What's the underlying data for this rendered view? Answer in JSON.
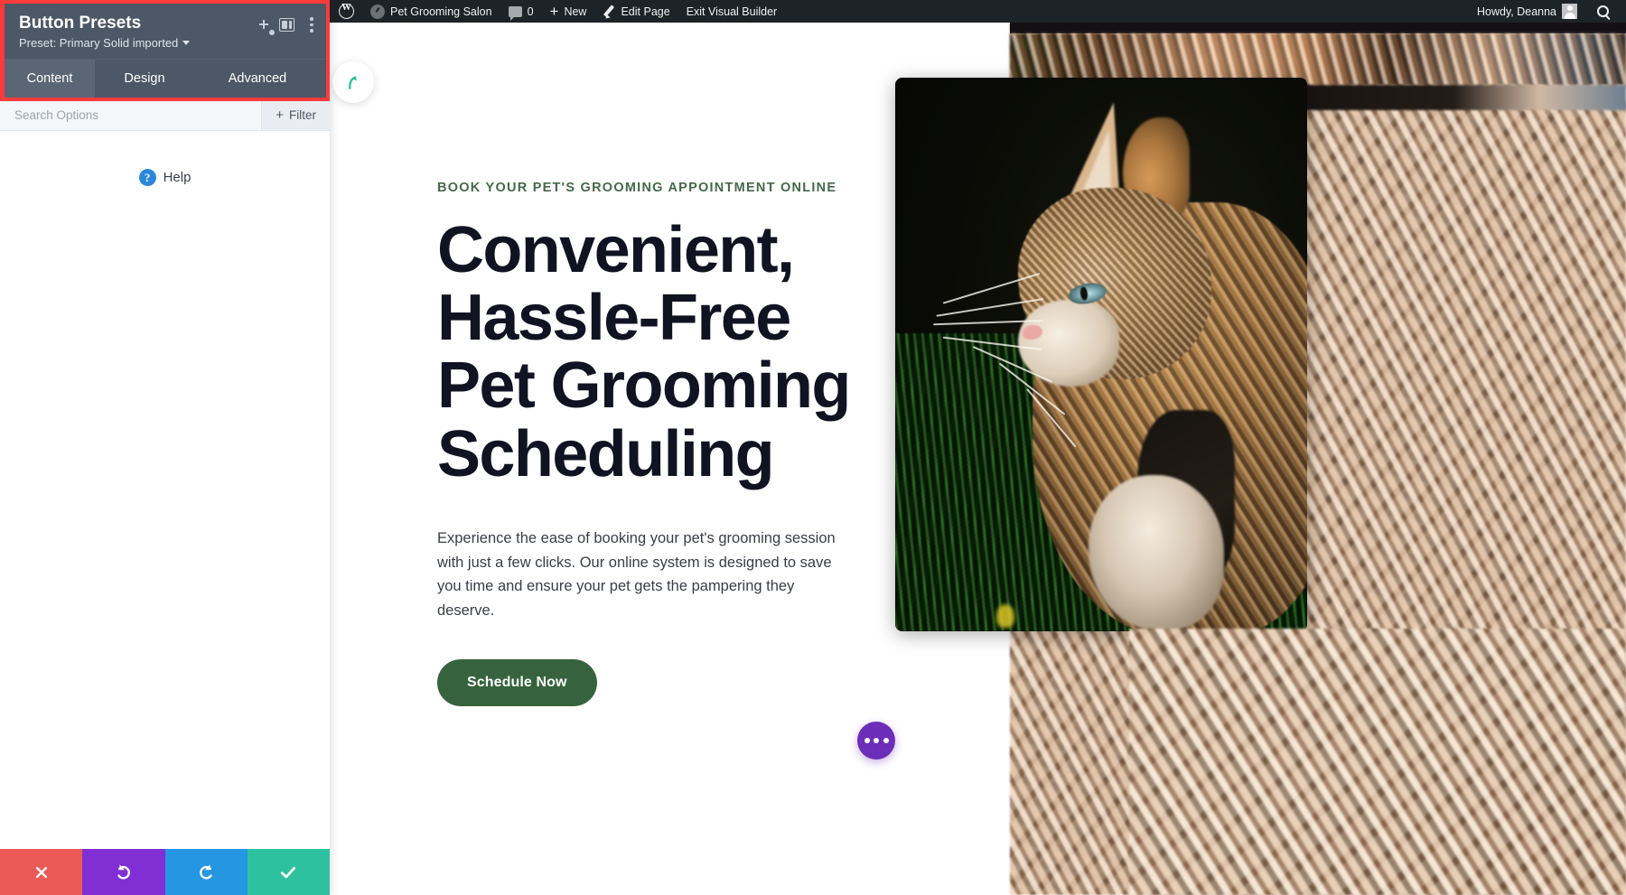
{
  "adminbar": {
    "wp_logo_name": "wordpress-logo-icon",
    "site_name": "Pet Grooming Salon",
    "comment_count": "0",
    "new_label": "New",
    "edit_page_label": "Edit Page",
    "exit_builder_label": "Exit Visual Builder",
    "howdy_label": "Howdy, Deanna",
    "background": "#1d2327"
  },
  "panel": {
    "title": "Button Presets",
    "subtitle": "Preset: Primary Solid imported",
    "highlight_color": "#ff3a3a",
    "header_bg": "#4c5866",
    "tabs": [
      {
        "label": "Content",
        "active": true
      },
      {
        "label": "Design",
        "active": false
      },
      {
        "label": "Advanced",
        "active": false
      }
    ],
    "search": {
      "placeholder": "Search Options",
      "value": ""
    },
    "filter_label": "Filter",
    "help_label": "Help",
    "actions": [
      {
        "name": "close",
        "glyph": "✕",
        "color": "#eb5a56"
      },
      {
        "name": "undo",
        "glyph": "↺",
        "color": "#7f2fd4"
      },
      {
        "name": "redo",
        "glyph": "↻",
        "color": "#2596e2"
      },
      {
        "name": "save",
        "glyph": "✓",
        "color": "#2ec1a0"
      }
    ]
  },
  "hero": {
    "eyebrow": "BOOK YOUR PET'S GROOMING APPOINTMENT ONLINE",
    "eyebrow_color": "#46684a",
    "title": "Convenient, Hassle-Free Pet Grooming Scheduling",
    "paragraph": "Experience the ease of booking your pet's grooming session with just a few clicks. Our online system is designed to save you time and ensure your pet gets the pampering they deserve.",
    "cta_label": "Schedule Now",
    "cta_color": "#36633d"
  },
  "floating": {
    "fab_name": "divi-menu-fab",
    "fab_color": "#6c2eb9",
    "return_pill_name": "return-arrow-icon",
    "return_pill_color": "#2ec1a0"
  },
  "media": {
    "main_image_alt": "Calico cat in profile sitting in dark green grass",
    "background_image_alt": "Close-up of dry straw and hay"
  }
}
